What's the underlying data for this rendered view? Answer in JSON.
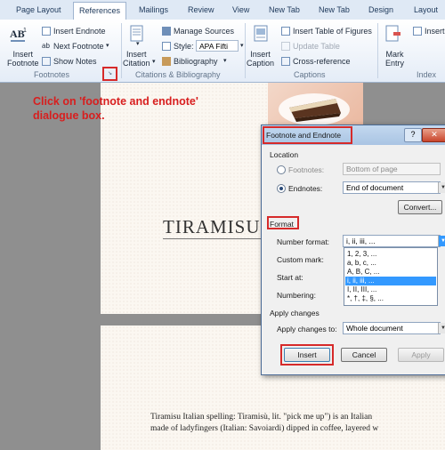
{
  "ribbon": {
    "tabs": [
      "Page Layout",
      "References",
      "Mailings",
      "Review",
      "View",
      "New Tab",
      "New Tab",
      "Design",
      "Layout"
    ],
    "active_tab": "References",
    "footnotes": {
      "insert_footnote": [
        "Insert",
        "Footnote"
      ],
      "insert_endnote": "Insert Endnote",
      "next_footnote": "Next Footnote",
      "show_notes": "Show Notes",
      "group_label": "Footnotes"
    },
    "citations": {
      "insert_citation": [
        "Insert",
        "Citation"
      ],
      "manage_sources": "Manage Sources",
      "style_label": "Style:",
      "style_value": "APA Fifti",
      "bibliography": "Bibliography",
      "group_label": "Citations & Bibliography"
    },
    "captions": {
      "insert_caption": [
        "Insert",
        "Caption"
      ],
      "insert_table_of_figures": "Insert Table of Figures",
      "update_table": "Update Table",
      "cross_reference": "Cross-reference",
      "group_label": "Captions"
    },
    "index": {
      "mark_entry": [
        "Mark",
        "Entry"
      ],
      "insert": "Insert",
      "group_label": "Index"
    }
  },
  "annotation": "Click on 'footnote and endnote'\ndialogue box.",
  "document": {
    "title": "TIRAMISU",
    "body_lines": [
      "Tiramisu Italian spelling: Tiramisù, lit. \"pick me up\") is an Italian",
      "made of ladyfingers (Italian: Savoiardi) dipped in coffee, layered w"
    ]
  },
  "dialog": {
    "title": "Footnote and Endnote",
    "help": "?",
    "close": "✕",
    "location_label": "Location",
    "footnotes_label": "Footnotes:",
    "footnotes_value": "Bottom of page",
    "endnotes_label": "Endnotes:",
    "endnotes_value": "End of document",
    "convert_button": "Convert...",
    "format_label": "Format",
    "number_format_label": "Number format:",
    "number_format_value": "i, ii, iii, ...",
    "custom_mark_label": "Custom mark:",
    "start_at_label": "Start at:",
    "numbering_label": "Numbering:",
    "number_format_options": [
      "1, 2, 3, ...",
      "a, b, c, ...",
      "A, B, C, ...",
      "i, ii, iii, ...",
      "I, II, III, ...",
      "*, †, ‡, §, ..."
    ],
    "selected_option_index": 3,
    "apply_changes_label": "Apply changes",
    "apply_changes_to_label": "Apply changes to:",
    "apply_changes_to_value": "Whole document",
    "insert_button": "Insert",
    "cancel_button": "Cancel",
    "apply_button": "Apply"
  },
  "colors": {
    "highlight_red": "#d62a2a",
    "selection_blue": "#3399ff"
  }
}
